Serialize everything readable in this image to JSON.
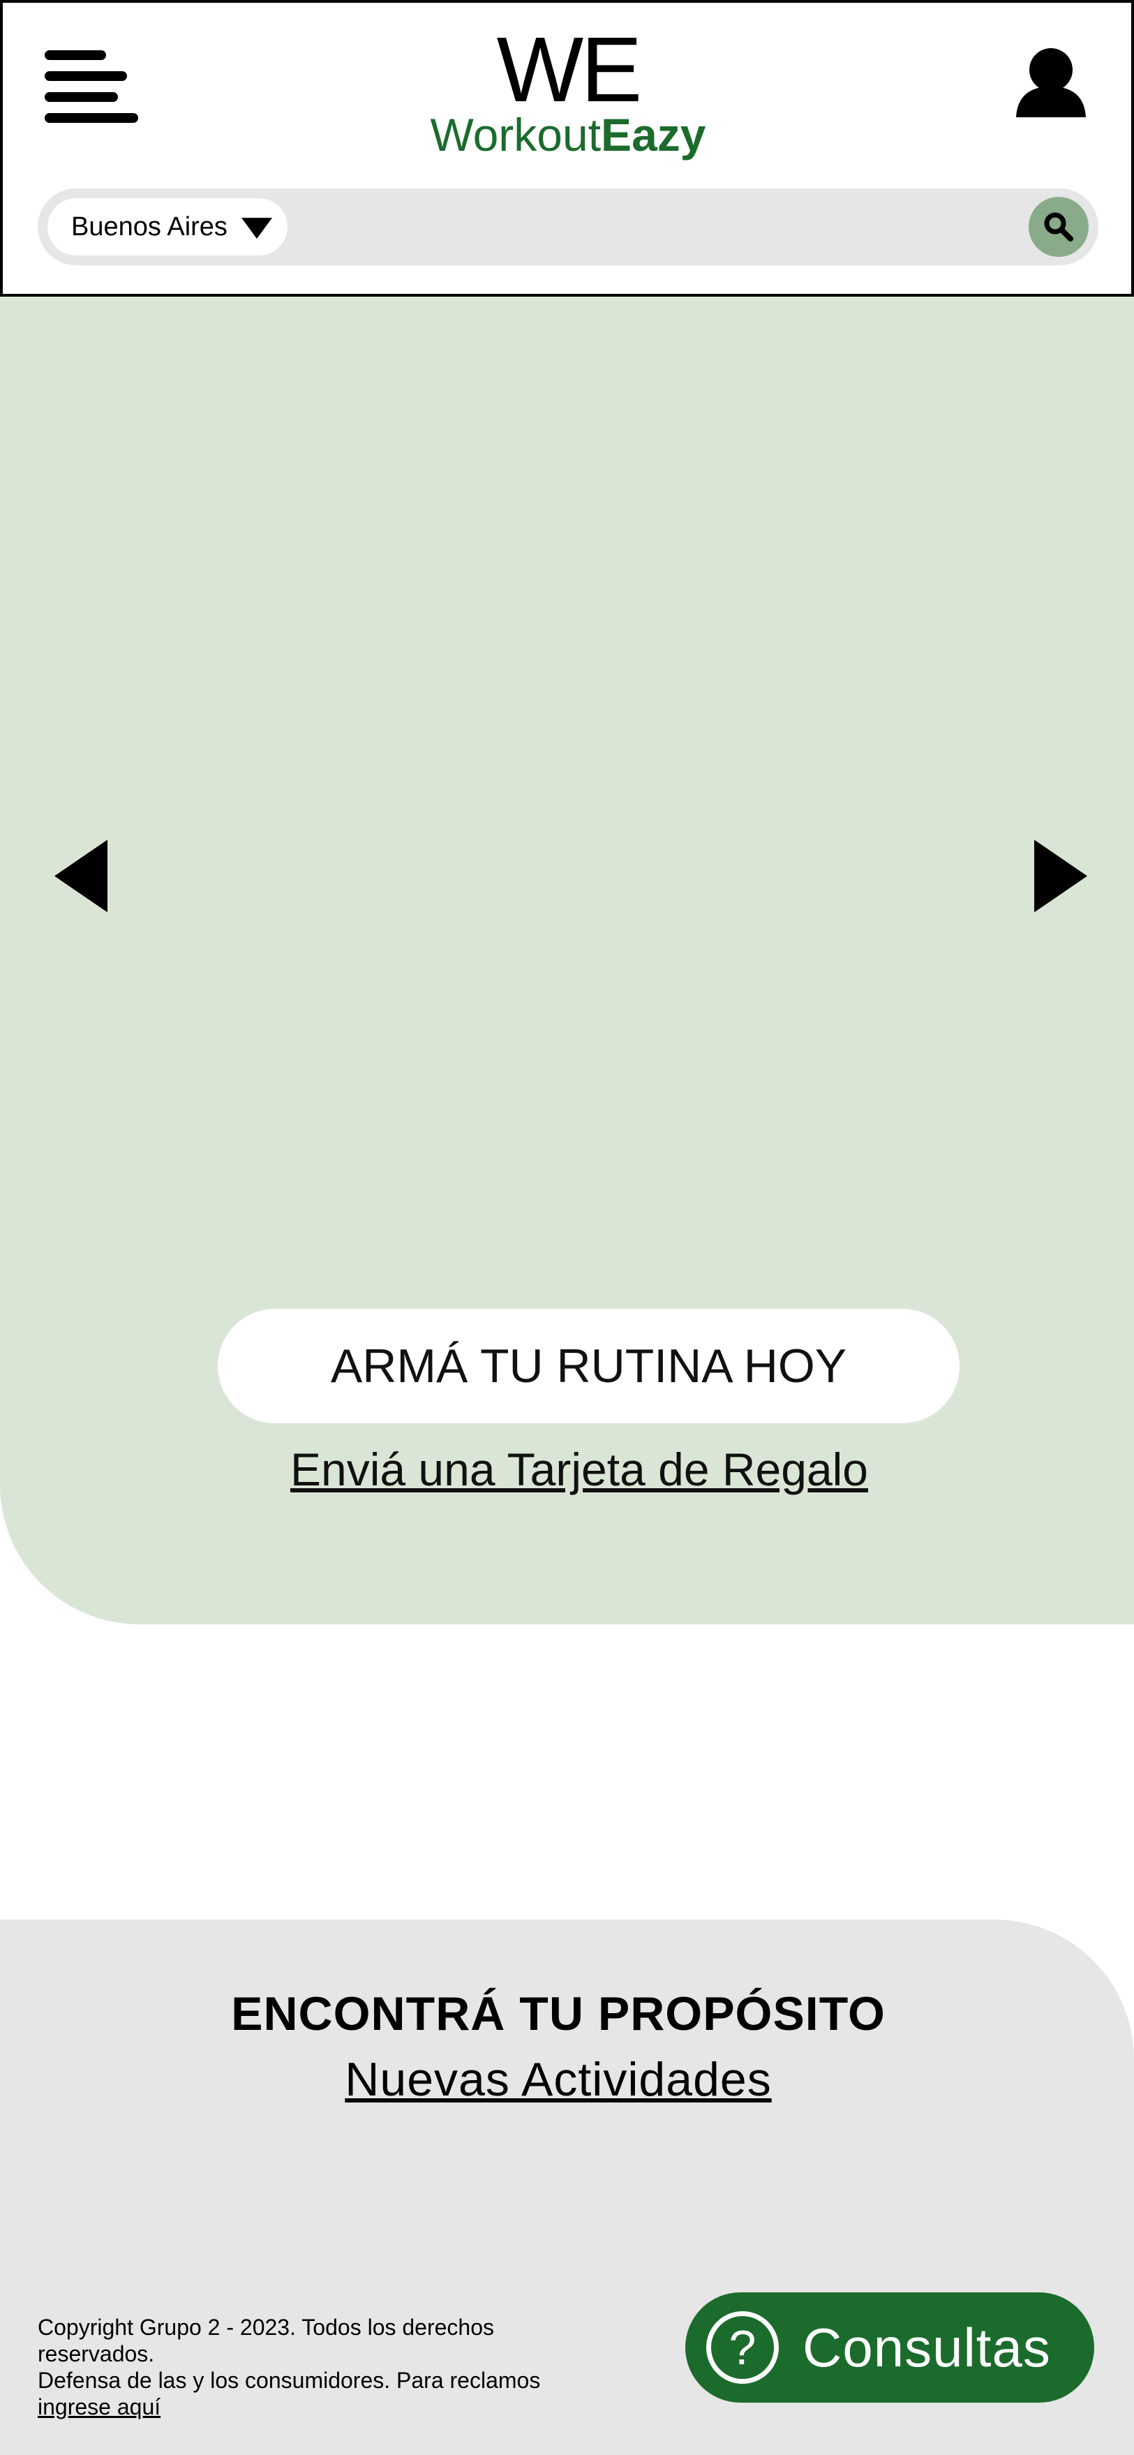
{
  "header": {
    "logo_mark": "WE",
    "logo_word_light": "Workout",
    "logo_word_bold": "Eazy",
    "menu_icon": "hamburger-menu-icon",
    "user_icon": "user-icon"
  },
  "search": {
    "city": "Buenos Aires",
    "dropdown_icon": "caret-down-icon",
    "search_icon": "magnifier-icon"
  },
  "hero": {
    "cta_label": "ARMÁ TU RUTINA HOY",
    "gift_link": "Enviá una Tarjeta de Regalo",
    "prev_icon": "arrow-left-icon",
    "next_icon": "arrow-right-icon"
  },
  "purpose": {
    "title": "ENCONTRÁ TU PROPÓSITO",
    "link": "Nuevas Actividades"
  },
  "footer": {
    "copyright": "Copyright Grupo 2 - 2023. Todos los derechos reservados.",
    "consumer": "Defensa de las y los consumidores. Para reclamos",
    "consumer_link": "ingrese aquí"
  },
  "help": {
    "label": "Consultas",
    "icon_glyph": "?"
  },
  "colors": {
    "brand_green": "#1b6b2d",
    "hero_bg": "#dae6d5",
    "search_btn": "#8aab8a",
    "panel_gray": "#e6e6e6"
  }
}
